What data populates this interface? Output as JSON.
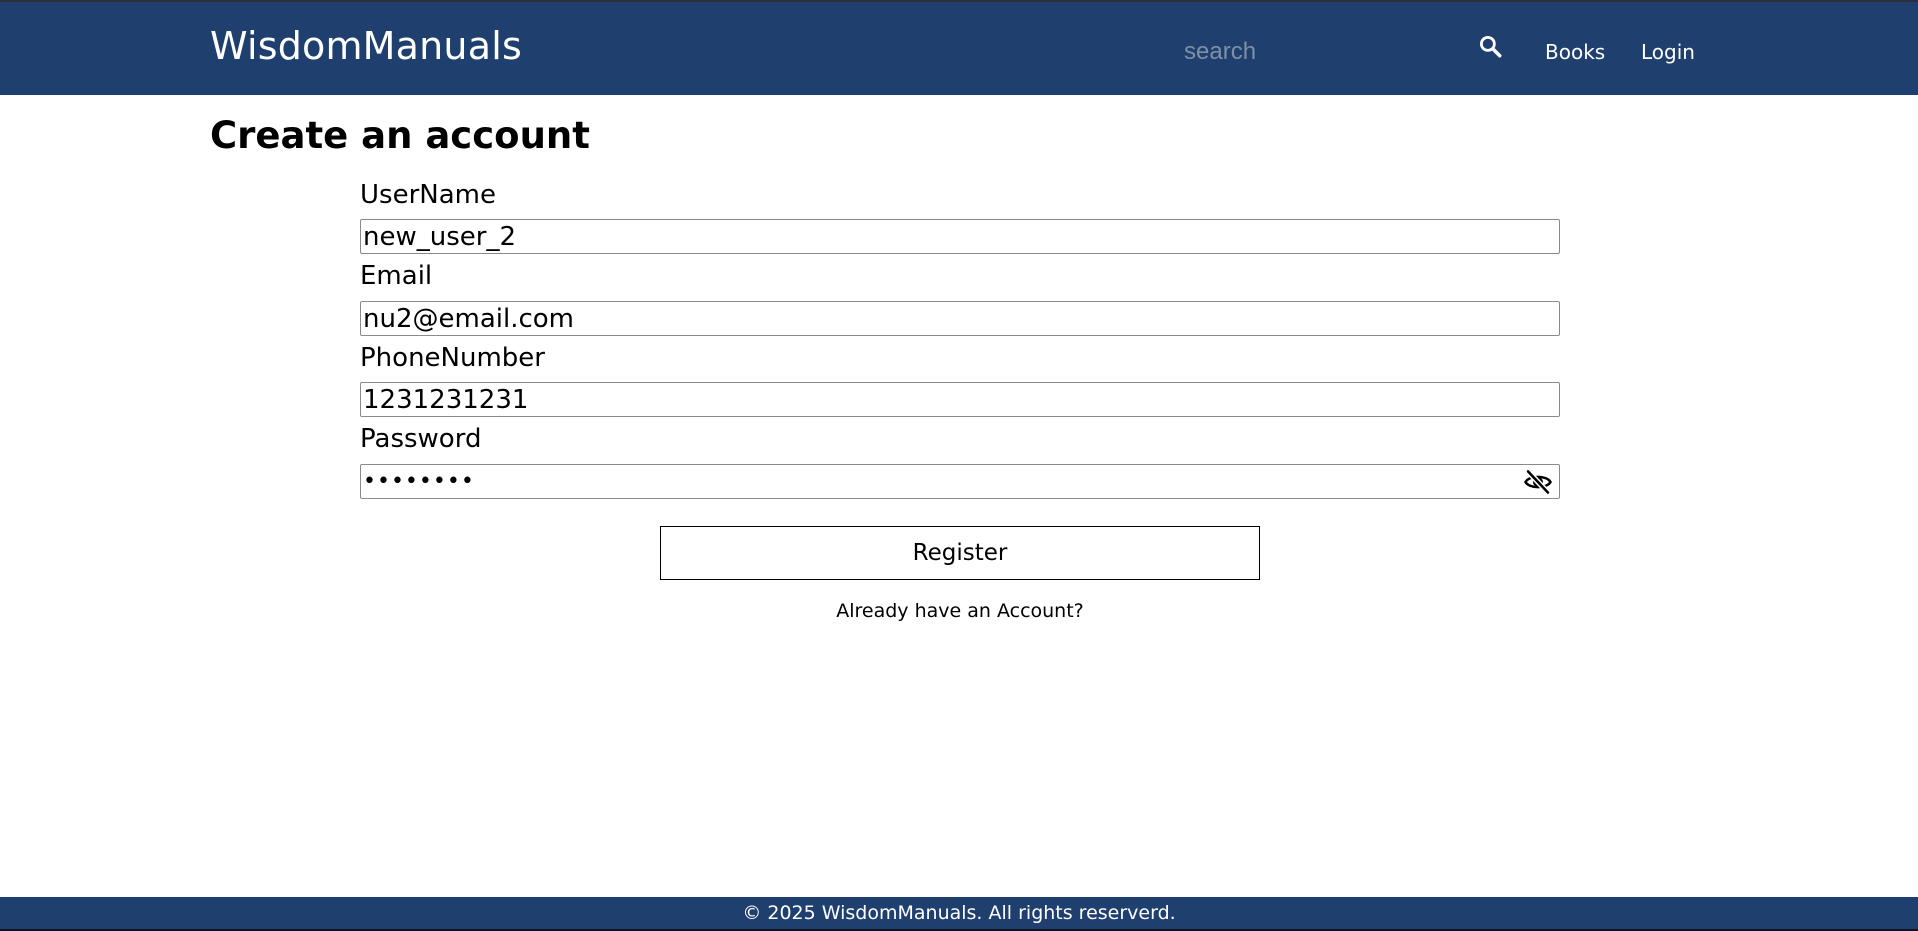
{
  "header": {
    "brand": "WisdomManuals",
    "search_placeholder": "search",
    "search_icon": "search-icon",
    "nav_books": "Books",
    "nav_login": "Login"
  },
  "main": {
    "title": "Create an account",
    "fields": {
      "username": {
        "label": "UserName",
        "value": "new_user_2"
      },
      "email": {
        "label": "Email",
        "value": "nu2@email.com"
      },
      "phone": {
        "label": "PhoneNumber",
        "value": "1231231231"
      },
      "password": {
        "label": "Password",
        "value": "••••••••",
        "toggle_icon": "eye-off-icon"
      }
    },
    "register_label": "Register",
    "login_prompt": "Already have an Account?"
  },
  "footer": {
    "text": "© 2025 WisdomManuals. All rights reserverd."
  },
  "colors": {
    "header_bg": "#1f3f6e",
    "footer_bg": "#1f3f6e",
    "text_on_dark": "#ffffff",
    "search_placeholder": "#7f8fa6"
  }
}
